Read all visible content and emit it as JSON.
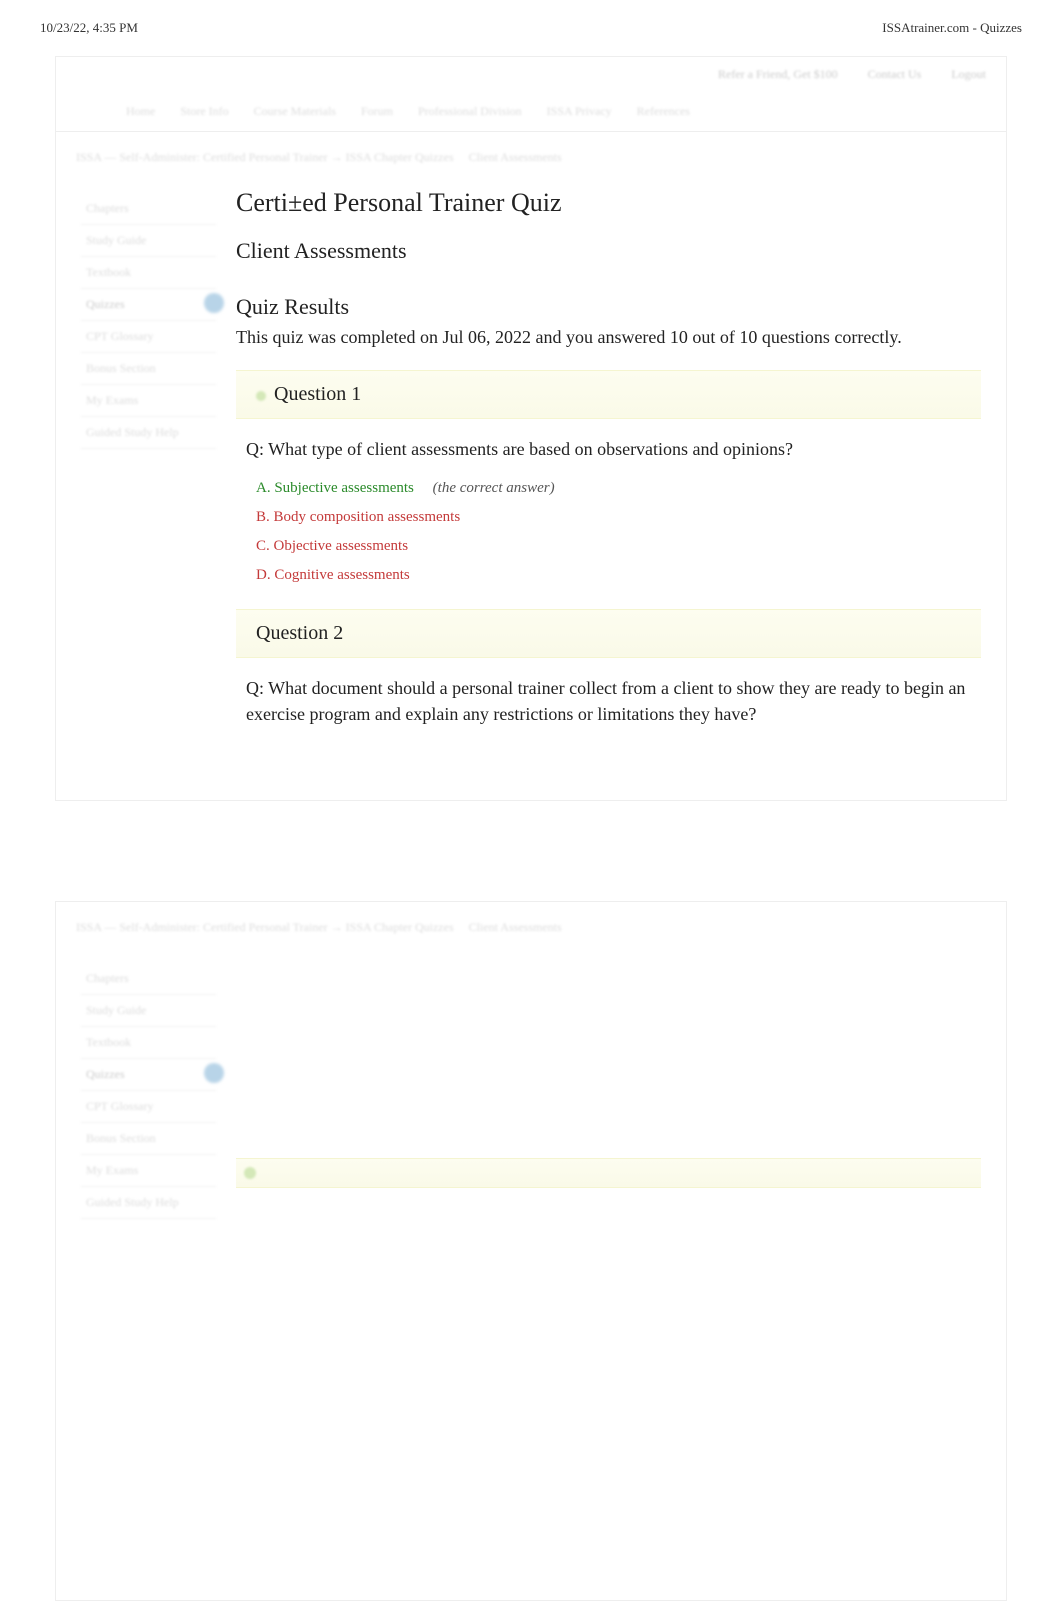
{
  "print_header": {
    "datetime": "10/23/22, 4:35 PM",
    "title": "ISSAtrainer.com - Quizzes"
  },
  "top_links": [
    "Refer a Friend, Get $100",
    "Contact Us",
    "Logout"
  ],
  "nav": [
    "Home",
    "Store Info",
    "Course Materials",
    "Forum",
    "Professional Division",
    "ISSA Privacy",
    "References"
  ],
  "breadcrumb": {
    "path": "ISSA — Self-Administer: Certified Personal Trainer → ISSA Chapter Quizzes",
    "current": "Client Assessments"
  },
  "sidebar": {
    "items": [
      {
        "label": "Chapters"
      },
      {
        "label": "Study Guide"
      },
      {
        "label": "Textbook"
      },
      {
        "label": "Quizzes",
        "active": true,
        "badge": true
      },
      {
        "label": "CPT Glossary"
      },
      {
        "label": "Bonus Section"
      },
      {
        "label": "My Exams"
      },
      {
        "label": "Guided Study Help"
      }
    ]
  },
  "quiz": {
    "title": "Certi±ed Personal Trainer Quiz",
    "subtitle": "Client Assessments",
    "results_heading": "Quiz Results",
    "results_text": "This quiz was completed on Jul 06, 2022 and you answered 10 out of 10 questions correctly.",
    "questions": [
      {
        "number": "Question 1",
        "text": "Q: What type of client assessments are based on observations and opinions?",
        "answers": [
          {
            "label": "A. Subjective assessments",
            "correct": true,
            "note": "(the correct answer)"
          },
          {
            "label": "B. Body composition assessments",
            "correct": false
          },
          {
            "label": "C. Objective assessments",
            "correct": false
          },
          {
            "label": "D. Cognitive assessments",
            "correct": false
          }
        ]
      },
      {
        "number": "Question 2",
        "text": "Q: What document should a personal trainer collect from a client to show they are ready to begin an exercise program and explain any restrictions or limitations they have?"
      }
    ]
  }
}
